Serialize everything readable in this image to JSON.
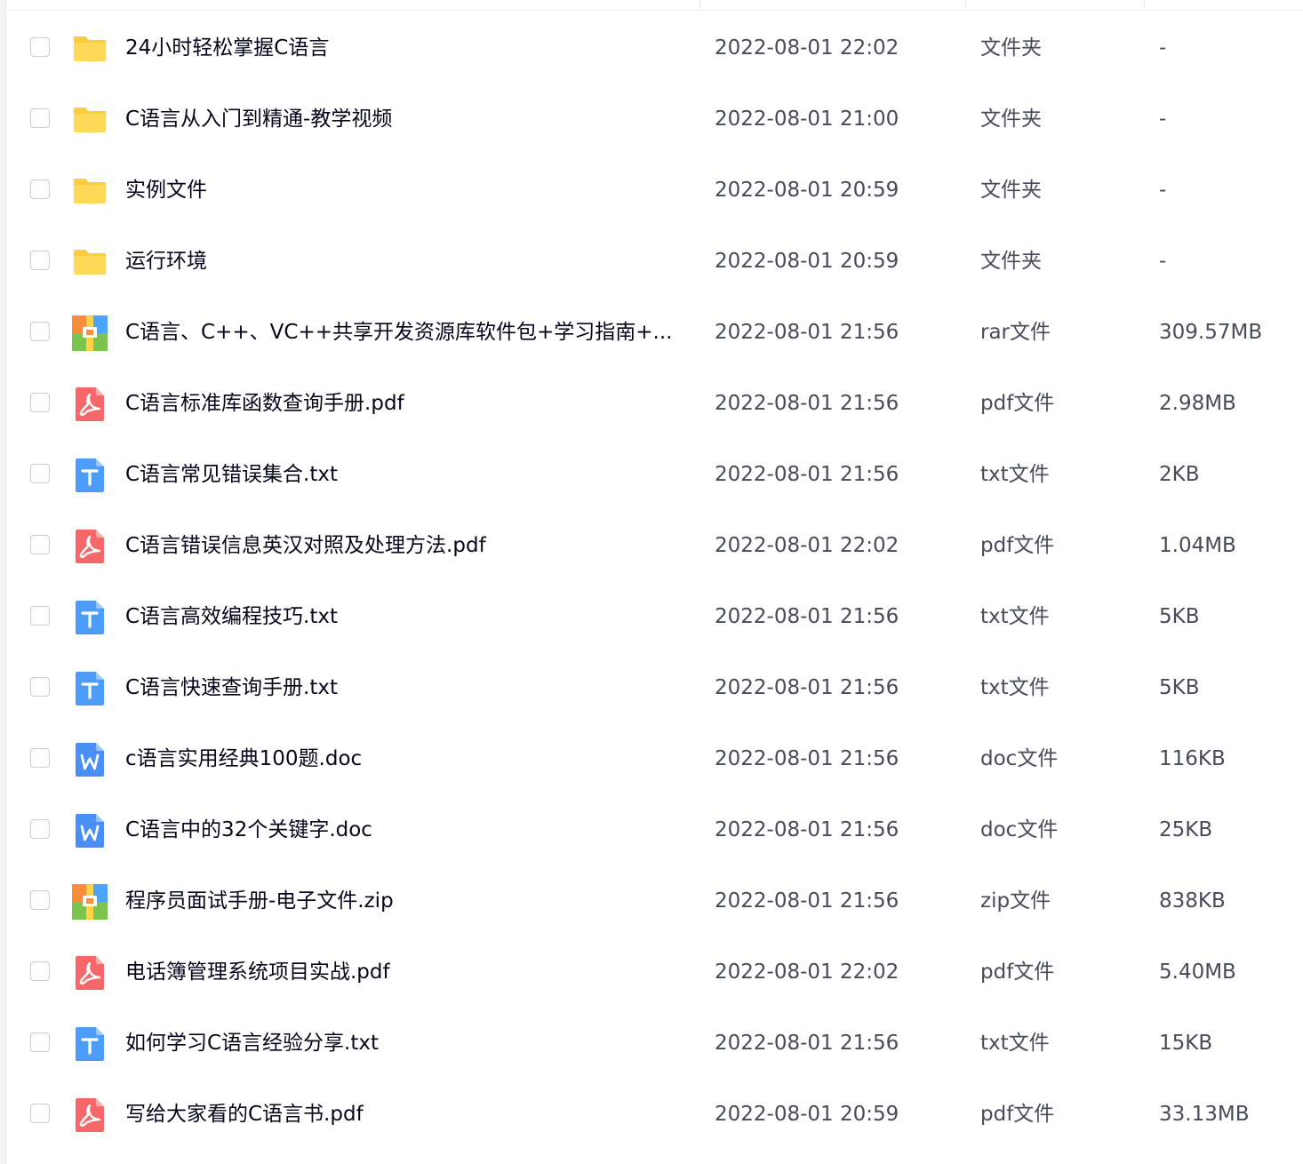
{
  "files": [
    {
      "name": "24小时轻松掌握C语言",
      "date": "2022-08-01 22:02",
      "type": "文件夹",
      "size": "-",
      "icon": "folder-icon"
    },
    {
      "name": "C语言从入门到精通-教学视频",
      "date": "2022-08-01 21:00",
      "type": "文件夹",
      "size": "-",
      "icon": "folder-icon"
    },
    {
      "name": "实例文件",
      "date": "2022-08-01 20:59",
      "type": "文件夹",
      "size": "-",
      "icon": "folder-icon"
    },
    {
      "name": "运行环境",
      "date": "2022-08-01 20:59",
      "type": "文件夹",
      "size": "-",
      "icon": "folder-icon"
    },
    {
      "name": "C语言、C++、VC++共享开发资源库软件包+学习指南+...",
      "date": "2022-08-01 21:56",
      "type": "rar文件",
      "size": "309.57MB",
      "icon": "archive-icon"
    },
    {
      "name": "C语言标准库函数查询手册.pdf",
      "date": "2022-08-01 21:56",
      "type": "pdf文件",
      "size": "2.98MB",
      "icon": "pdf-icon"
    },
    {
      "name": "C语言常见错误集合.txt",
      "date": "2022-08-01 21:56",
      "type": "txt文件",
      "size": "2KB",
      "icon": "txt-icon"
    },
    {
      "name": "C语言错误信息英汉对照及处理方法.pdf",
      "date": "2022-08-01 22:02",
      "type": "pdf文件",
      "size": "1.04MB",
      "icon": "pdf-icon"
    },
    {
      "name": "C语言高效编程技巧.txt",
      "date": "2022-08-01 21:56",
      "type": "txt文件",
      "size": "5KB",
      "icon": "txt-icon"
    },
    {
      "name": "C语言快速查询手册.txt",
      "date": "2022-08-01 21:56",
      "type": "txt文件",
      "size": "5KB",
      "icon": "txt-icon"
    },
    {
      "name": "c语言实用经典100题.doc",
      "date": "2022-08-01 21:56",
      "type": "doc文件",
      "size": "116KB",
      "icon": "doc-icon"
    },
    {
      "name": "C语言中的32个关键字.doc",
      "date": "2022-08-01 21:56",
      "type": "doc文件",
      "size": "25KB",
      "icon": "doc-icon"
    },
    {
      "name": "程序员面试手册-电子文件.zip",
      "date": "2022-08-01 21:56",
      "type": "zip文件",
      "size": "838KB",
      "icon": "archive-icon"
    },
    {
      "name": "电话簿管理系统项目实战.pdf",
      "date": "2022-08-01 22:02",
      "type": "pdf文件",
      "size": "5.40MB",
      "icon": "pdf-icon"
    },
    {
      "name": "如何学习C语言经验分享.txt",
      "date": "2022-08-01 21:56",
      "type": "txt文件",
      "size": "15KB",
      "icon": "txt-icon"
    },
    {
      "name": "写给大家看的C语言书.pdf",
      "date": "2022-08-01 20:59",
      "type": "pdf文件",
      "size": "33.13MB",
      "icon": "pdf-icon"
    }
  ],
  "colors": {
    "folder": "#ffcc3d",
    "pdf": "#f5676b",
    "txt": "#4c9cf8",
    "doc": "#4a8ff6",
    "archive_orange": "#fa8c3c",
    "archive_blue": "#4aa4f8",
    "archive_green": "#7cc44e",
    "archive_yellow": "#ffd248",
    "checkbox_border": "#c9ccd2"
  }
}
